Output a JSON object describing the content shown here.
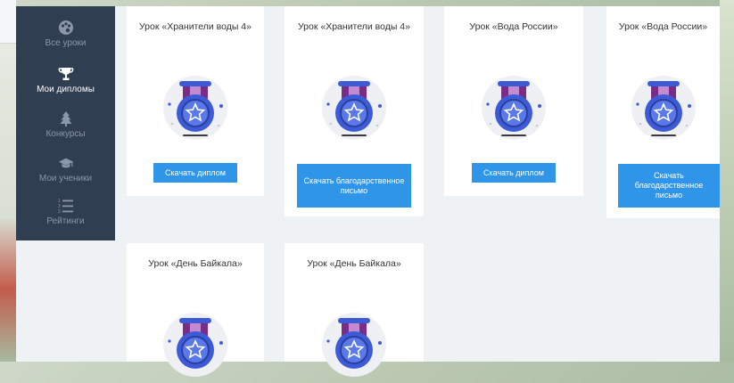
{
  "sidebar": {
    "items": [
      {
        "label": "Все уроки",
        "icon": "palette-icon",
        "active": false
      },
      {
        "label": "Мои дипломы",
        "icon": "trophy-icon",
        "active": true
      },
      {
        "label": "Конкурсы",
        "icon": "tree-icon",
        "active": false
      },
      {
        "label": "Мои ученики",
        "icon": "graduation-cap-icon",
        "active": false
      },
      {
        "label": "Рейтинги",
        "icon": "ordered-list-icon",
        "active": false
      }
    ]
  },
  "cards": [
    {
      "title": "Урок «Хранители воды 4»",
      "button": "Скачать диплом"
    },
    {
      "title": "Урок «Хранители воды 4»",
      "button": "Скачать благодарственное письмо"
    },
    {
      "title": "Урок «Вода России»",
      "button": "Скачать диплом"
    },
    {
      "title": "Урок «Вода России»",
      "button": "Скачать благодарственное письмо"
    },
    {
      "title": "Урок «День Байкала»",
      "button": ""
    },
    {
      "title": "Урок «День Байкала»",
      "button": ""
    }
  ],
  "colors": {
    "sidebar_bg": "#2f3e51",
    "button_bg": "#2f95e8",
    "medal_blue": "#3d5bd6",
    "medal_purple": "#7a2d87"
  }
}
